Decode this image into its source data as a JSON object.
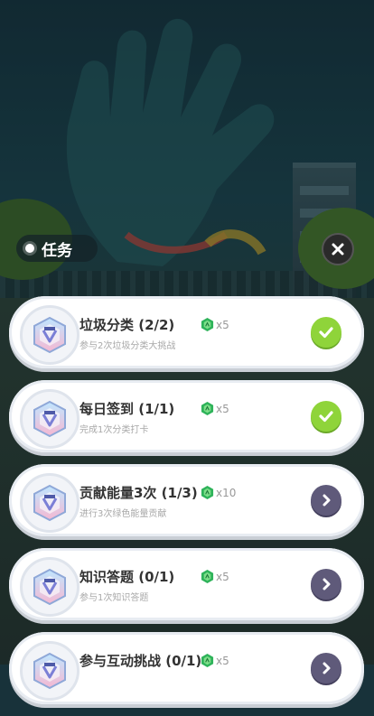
{
  "panel": {
    "title": "任务"
  },
  "tasks": [
    {
      "name": "垃圾分类 (2/2)",
      "desc": "参与2次垃圾分类大挑战",
      "reward": "x5",
      "status": "done"
    },
    {
      "name": "每日签到 (1/1)",
      "desc": "完成1次分类打卡",
      "reward": "x5",
      "status": "done"
    },
    {
      "name": "贡献能量3次 (1/3)",
      "desc": "进行3次绿色能量贡献",
      "reward": "x10",
      "status": "go"
    },
    {
      "name": "知识答题 (0/1)",
      "desc": "参与1次知识答题",
      "reward": "x5",
      "status": "go"
    },
    {
      "name": "参与互动挑战 (0/1)",
      "desc": "",
      "reward": "x5",
      "status": "go"
    }
  ],
  "colors": {
    "done": "#8fd43a",
    "go": "#5f5a7a",
    "gem": "#2fb35a"
  },
  "icons": {
    "close": "close-icon",
    "done": "checkmark-icon",
    "go": "chevron-right-icon",
    "reward": "green-gem-icon",
    "task": "hexagon-badge-icon"
  }
}
